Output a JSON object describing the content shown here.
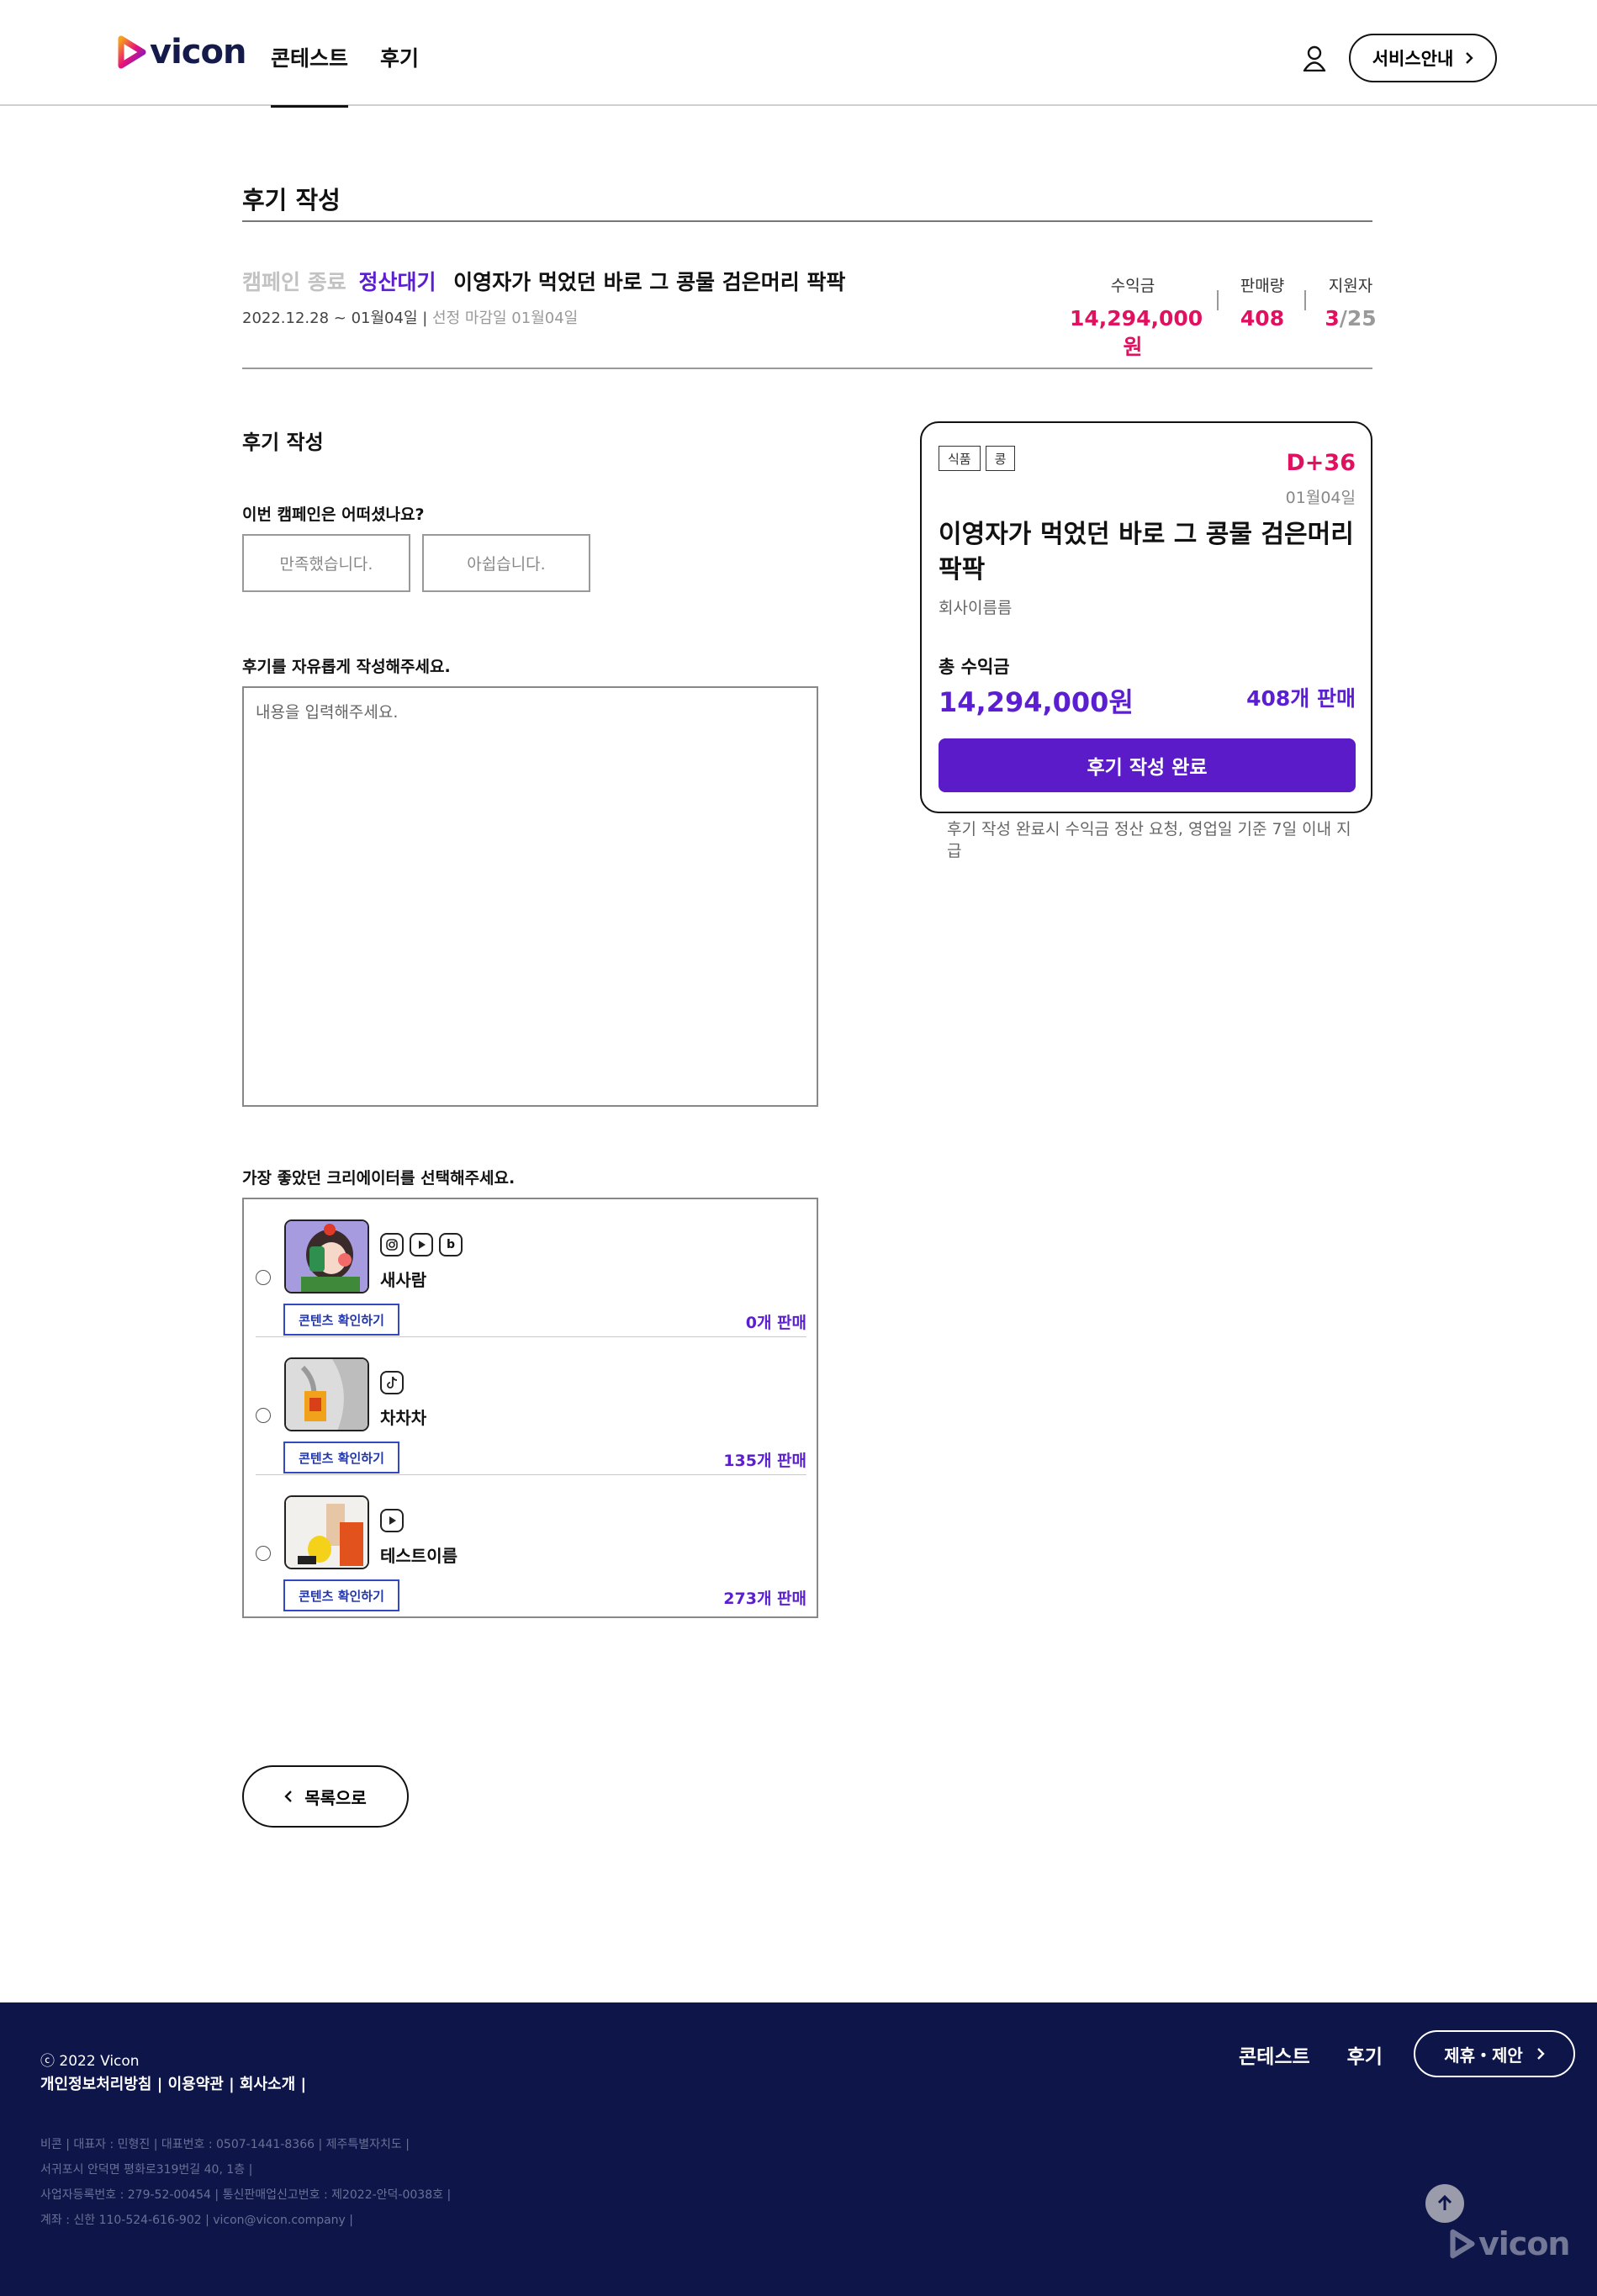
{
  "header": {
    "logo_text": "vicon",
    "nav": [
      "콘테스트",
      "후기"
    ],
    "service_button": "서비스안내"
  },
  "page_title": "후기 작성",
  "campaign": {
    "status_ended": "캠페인 종료",
    "status_settle": "정산대기",
    "title": "이영자가 먹었던 바로 그 콩물 검은머리 팍팍",
    "dates": "2022.12.28 ~ 01월04일 |",
    "selection_deadline": "선정 마감일 01월04일",
    "stats": {
      "revenue_label": "수익금",
      "revenue_value": "14,294,000원",
      "sales_label": "판매량",
      "sales_value": "408",
      "applicants_label": "지원자",
      "applicants_current": "3",
      "applicants_total": "/25"
    }
  },
  "form": {
    "section_title": "후기 작성",
    "satisfaction_question": "이번 캠페인은 어떠셨나요?",
    "choice_satisfied": "만족했습니다.",
    "choice_unsatisfied": "아쉽습니다.",
    "review_label": "후기를 자유롭게 작성해주세요.",
    "review_placeholder": "내용을 입력해주세요.",
    "creator_question": "가장 좋았던 크리에이터를 선택해주세요.",
    "content_button": "콘텐츠 확인하기",
    "creators": [
      {
        "name": "새사람",
        "sns": [
          "instagram-icon",
          "youtube-icon",
          "blog-icon"
        ],
        "sales": "0개 판매"
      },
      {
        "name": "차차차",
        "sns": [
          "tiktok-icon"
        ],
        "sales": "135개 판매"
      },
      {
        "name": "테스트이름",
        "sns": [
          "youtube-icon"
        ],
        "sales": "273개 판매"
      }
    ],
    "back_button": "목록으로"
  },
  "card": {
    "tags": [
      "식품",
      "콩"
    ],
    "dday": "D+36",
    "date": "01월04일",
    "title": "이영자가 먹었던 바로 그 콩물 검은머리 팍팍",
    "company": "회사이름름",
    "total_label": "총 수익금",
    "total_value": "14,294,000원",
    "sales": "408개 판매",
    "submit_button": "후기 작성 완료",
    "note": "후기 작성 완료시 수익금 정산 요청, 영업일 기준 7일 이내 지급"
  },
  "footer": {
    "copyright": "ⓒ 2022 Vicon",
    "links": "개인정보처리방침 | 이용약관 | 회사소개 |",
    "nav": [
      "콘테스트",
      "후기"
    ],
    "partner_button": "제휴・제안",
    "info_lines": [
      "비콘 | 대표자 : 민형진 | 대표번호 : 0507-1441-8366 | 제주특별자치도 |",
      "서귀포시 안덕면 평화로319번길 40, 1층 |",
      "사업자등록번호 : 279-52-00454 | 통신판매업신고번호 : 제2022-안덕-0038호 |",
      "계좌 : 신한 110-524-616-902 | vicon@vicon.company |"
    ],
    "logo_text": "vicon"
  },
  "colors": {
    "accent_purple": "#5b1fd1",
    "accent_pink": "#e0115f",
    "footer_bg": "#0d1549"
  }
}
